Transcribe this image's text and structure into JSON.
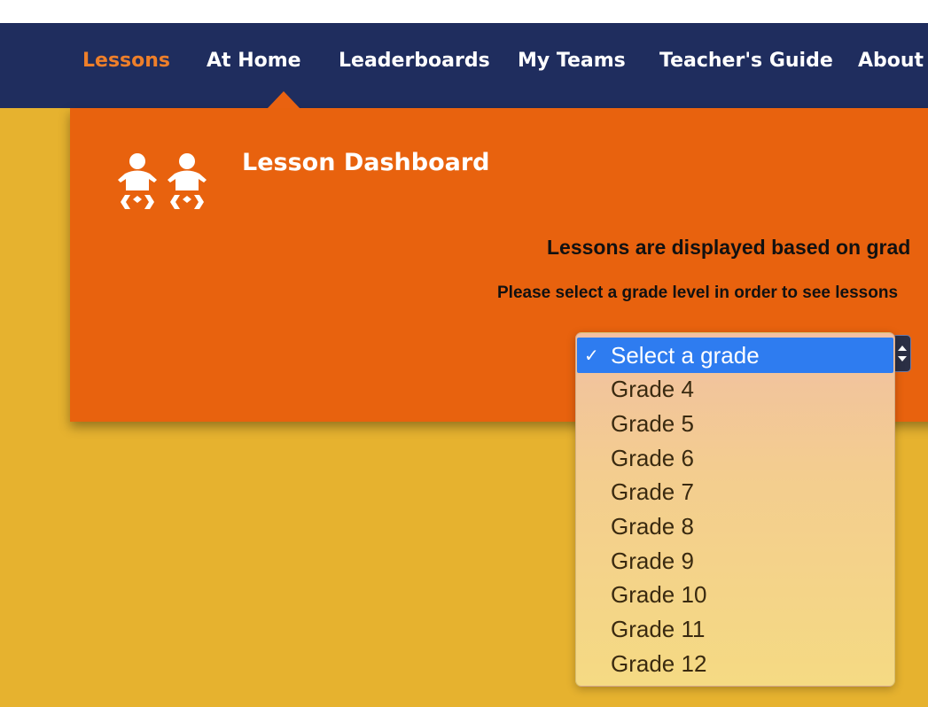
{
  "nav": {
    "items": [
      {
        "label": "Lessons",
        "active": true
      },
      {
        "label": "At Home",
        "active": false
      },
      {
        "label": "Leaderboards",
        "active": false
      },
      {
        "label": "My Teams",
        "active": false
      },
      {
        "label": "Teacher's Guide",
        "active": false
      },
      {
        "label": "About",
        "active": false
      }
    ]
  },
  "dashboard": {
    "title": "Lesson Dashboard",
    "icon": "two-children-icon",
    "message_primary": "Lessons are displayed based on grad",
    "message_secondary": "Please select a grade level in order to see lessons"
  },
  "grade_select": {
    "selected": "Select a grade",
    "options": [
      "Grade 4",
      "Grade 5",
      "Grade 6",
      "Grade 7",
      "Grade 8",
      "Grade 9",
      "Grade 10",
      "Grade 11",
      "Grade 12"
    ]
  },
  "colors": {
    "nav_bg": "#1f2d5e",
    "nav_active": "#ee7f2a",
    "panel_bg": "#e8620e",
    "page_bg": "#e6b22f",
    "highlight": "#2e7cf0"
  }
}
